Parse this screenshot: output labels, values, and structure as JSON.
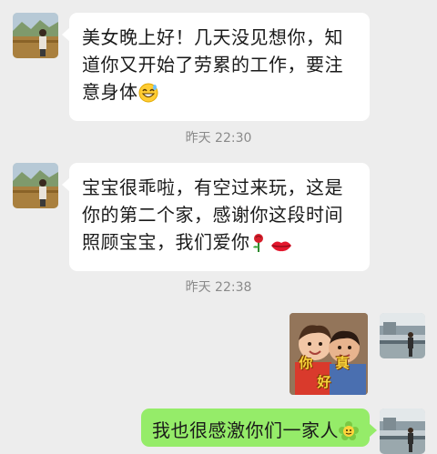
{
  "messages": [
    {
      "sender": "contact",
      "text": "美女晚上好！几天没见想你，知道你又开始了劳累的工作，要注意身体",
      "emoji": "grinning-sweat-emoji"
    },
    {
      "type": "timestamp",
      "text": "昨天 22:30"
    },
    {
      "sender": "contact",
      "text": "宝宝很乖啦，有空过来玩，这是你的第二个家，感谢你这段时间照顾宝宝，我们爱你",
      "emoji": [
        "rose-emoji",
        "lips-emoji"
      ]
    },
    {
      "type": "timestamp",
      "text": "昨天 22:38"
    },
    {
      "sender": "self",
      "type": "sticker",
      "caption": "你 真 好"
    },
    {
      "sender": "self",
      "text": "我也很感激你们一家人",
      "emoji": "flower-face-emoji"
    }
  ],
  "colors": {
    "background": "#ededed",
    "incoming_bubble": "#ffffff",
    "outgoing_bubble": "#95ec69",
    "timestamp_text": "#8a8a8a"
  }
}
